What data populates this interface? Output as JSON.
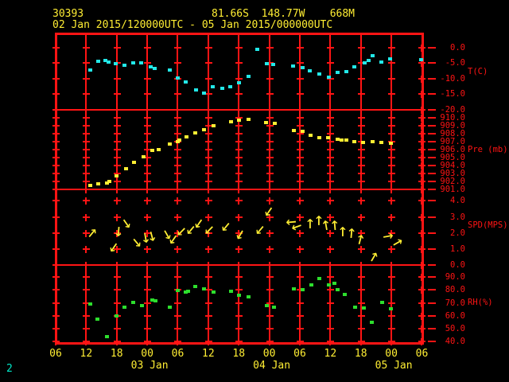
{
  "header": {
    "station_id": "30393",
    "location": "81.66S  148.77W    668M",
    "period": "02 Jan 2015/120000UTC - 05 Jan 2015/000000UTC"
  },
  "footer": {
    "page_number": "2"
  },
  "colors": {
    "grid_red": "#ff1414",
    "label_yellow": "#ffee33",
    "temp_cyan": "#22e8e8",
    "pressure_yellow": "#ffee33",
    "wind_yellow": "#ffee33",
    "rh_green": "#2dde2d",
    "page_teal": "#00e8c8"
  },
  "x_axis": {
    "hour_labels": [
      "06",
      "12",
      "18",
      "00",
      "06",
      "12",
      "18",
      "00",
      "06",
      "12",
      "18",
      "00",
      "06"
    ],
    "date_labels": [
      {
        "label": "03 Jan",
        "t": 18
      },
      {
        "label": "04 Jan",
        "t": 42
      },
      {
        "label": "05 Jan",
        "t": 66
      }
    ],
    "t_start_label": "06 UTC 02 Jan",
    "t_hours_total": 72
  },
  "chart_data": [
    {
      "type": "scatter",
      "name": "temperature",
      "ylabel": "T(C)",
      "units": "C",
      "ticks": [
        0,
        -5,
        -10,
        -15,
        -20
      ],
      "ylim": [
        -20,
        0
      ],
      "points": [
        [
          6.7,
          -7.1
        ],
        [
          8.3,
          -4.4
        ],
        [
          9.7,
          -4.2
        ],
        [
          10.3,
          -4.7
        ],
        [
          11.7,
          -5.2
        ],
        [
          13.5,
          -5.7
        ],
        [
          15.2,
          -5.0
        ],
        [
          16.7,
          -5.0
        ],
        [
          18.6,
          -6.3
        ],
        [
          19.4,
          -6.8
        ],
        [
          22.4,
          -7.3
        ],
        [
          23.9,
          -9.7
        ],
        [
          25.5,
          -11.0
        ],
        [
          27.5,
          -13.6
        ],
        [
          29.1,
          -14.7
        ],
        [
          30.8,
          -12.6
        ],
        [
          32.6,
          -13.1
        ],
        [
          34.3,
          -12.6
        ],
        [
          36.0,
          -11.3
        ],
        [
          37.9,
          -9.2
        ],
        [
          39.6,
          -0.5
        ],
        [
          41.5,
          -5.2
        ],
        [
          42.7,
          -5.5
        ],
        [
          46.6,
          -5.8
        ],
        [
          48.4,
          -6.4
        ],
        [
          49.9,
          -7.4
        ],
        [
          51.8,
          -8.6
        ],
        [
          53.7,
          -9.4
        ],
        [
          55.4,
          -8.1
        ],
        [
          57.0,
          -7.7
        ],
        [
          58.7,
          -6.1
        ],
        [
          60.6,
          -4.8
        ],
        [
          61.5,
          -4.1
        ],
        [
          62.2,
          -2.6
        ],
        [
          64.0,
          -4.6
        ],
        [
          65.7,
          -3.5
        ],
        [
          71.7,
          -3.8
        ]
      ]
    },
    {
      "type": "scatter",
      "name": "pressure",
      "ylabel": "Pre (mb)",
      "units": "mb",
      "ticks": [
        910,
        909,
        908,
        907,
        906,
        905,
        904,
        903,
        902,
        901
      ],
      "ylim": [
        901,
        910
      ],
      "points": [
        [
          6.8,
          901.5
        ],
        [
          8.3,
          901.7
        ],
        [
          10.0,
          901.8
        ],
        [
          10.4,
          902.0
        ],
        [
          11.9,
          902.7
        ],
        [
          13.7,
          903.6
        ],
        [
          15.4,
          904.4
        ],
        [
          17.2,
          905.1
        ],
        [
          18.9,
          905.9
        ],
        [
          20.1,
          906.0
        ],
        [
          22.3,
          906.7
        ],
        [
          23.9,
          907.0
        ],
        [
          24.3,
          907.2
        ],
        [
          25.7,
          907.6
        ],
        [
          27.3,
          908.1
        ],
        [
          29.1,
          908.5
        ],
        [
          31.0,
          909.0
        ],
        [
          34.4,
          909.5
        ],
        [
          35.9,
          909.7
        ],
        [
          37.8,
          909.8
        ],
        [
          41.2,
          909.4
        ],
        [
          43.0,
          909.3
        ],
        [
          46.7,
          908.4
        ],
        [
          48.4,
          908.3
        ],
        [
          50.1,
          907.8
        ],
        [
          51.7,
          907.5
        ],
        [
          53.5,
          907.5
        ],
        [
          55.3,
          907.3
        ],
        [
          56.1,
          907.2
        ],
        [
          57.0,
          907.2
        ],
        [
          58.7,
          907.0
        ],
        [
          60.3,
          906.9
        ],
        [
          62.2,
          907.0
        ],
        [
          63.9,
          906.9
        ],
        [
          65.8,
          906.8
        ]
      ]
    },
    {
      "type": "wind-arrows",
      "name": "wind-speed-direction",
      "ylabel": "SPD(MPS)",
      "units": "m/s",
      "ticks": [
        4,
        3,
        2,
        1,
        0
      ],
      "ylim": [
        0,
        4
      ],
      "points_format": "[hours, speed_mps, direction_deg_ccw_from_east]",
      "points": [
        [
          7.2,
          2.0,
          50
        ],
        [
          11.4,
          1.1,
          235
        ],
        [
          12.4,
          2.1,
          265
        ],
        [
          13.9,
          2.6,
          305
        ],
        [
          16.0,
          1.4,
          310
        ],
        [
          17.7,
          1.7,
          280
        ],
        [
          18.9,
          1.8,
          285
        ],
        [
          21.9,
          1.9,
          300
        ],
        [
          23.2,
          1.6,
          235
        ],
        [
          24.7,
          2.1,
          225
        ],
        [
          26.6,
          2.2,
          230
        ],
        [
          28.2,
          2.6,
          235
        ],
        [
          30.1,
          2.2,
          225
        ],
        [
          33.5,
          2.4,
          230
        ],
        [
          36.3,
          1.9,
          240
        ],
        [
          40.2,
          2.2,
          230
        ],
        [
          41.9,
          3.3,
          235
        ],
        [
          46.3,
          2.7,
          185
        ],
        [
          47.3,
          2.4,
          200
        ],
        [
          50.1,
          2.6,
          90
        ],
        [
          51.8,
          2.8,
          90
        ],
        [
          53.2,
          2.5,
          100
        ],
        [
          54.9,
          2.5,
          95
        ],
        [
          56.5,
          2.1,
          90
        ],
        [
          58.1,
          2.0,
          85
        ],
        [
          59.9,
          1.6,
          75
        ],
        [
          62.6,
          0.5,
          60
        ],
        [
          65.3,
          1.8,
          10
        ],
        [
          67.2,
          1.4,
          30
        ]
      ]
    },
    {
      "type": "scatter",
      "name": "relative-humidity",
      "ylabel": "RH(%)",
      "units": "%",
      "ticks": [
        90,
        80,
        70,
        60,
        50,
        40
      ],
      "ylim": [
        40,
        90
      ],
      "points": [
        [
          6.8,
          69.4
        ],
        [
          8.2,
          57.5
        ],
        [
          10.0,
          43.7
        ],
        [
          11.9,
          60.1
        ],
        [
          13.5,
          66.9
        ],
        [
          15.2,
          70.4
        ],
        [
          16.9,
          67.7
        ],
        [
          18.9,
          72.4
        ],
        [
          19.6,
          71.6
        ],
        [
          22.3,
          66.9
        ],
        [
          24.0,
          79.7
        ],
        [
          25.5,
          78.3
        ],
        [
          26.0,
          79.3
        ],
        [
          27.4,
          82.8
        ],
        [
          29.1,
          80.7
        ],
        [
          31.0,
          78.6
        ],
        [
          34.4,
          79.0
        ],
        [
          36.0,
          76.0
        ],
        [
          37.8,
          74.5
        ],
        [
          41.5,
          67.7
        ],
        [
          42.9,
          66.9
        ],
        [
          46.7,
          80.7
        ],
        [
          48.5,
          80.1
        ],
        [
          50.2,
          83.8
        ],
        [
          51.8,
          88.9
        ],
        [
          53.6,
          84.0
        ],
        [
          54.8,
          85.3
        ],
        [
          55.4,
          80.1
        ],
        [
          56.8,
          76.6
        ],
        [
          58.8,
          66.9
        ],
        [
          60.5,
          66.3
        ],
        [
          62.1,
          55.1
        ],
        [
          64.1,
          70.4
        ],
        [
          65.9,
          65.3
        ]
      ]
    }
  ]
}
